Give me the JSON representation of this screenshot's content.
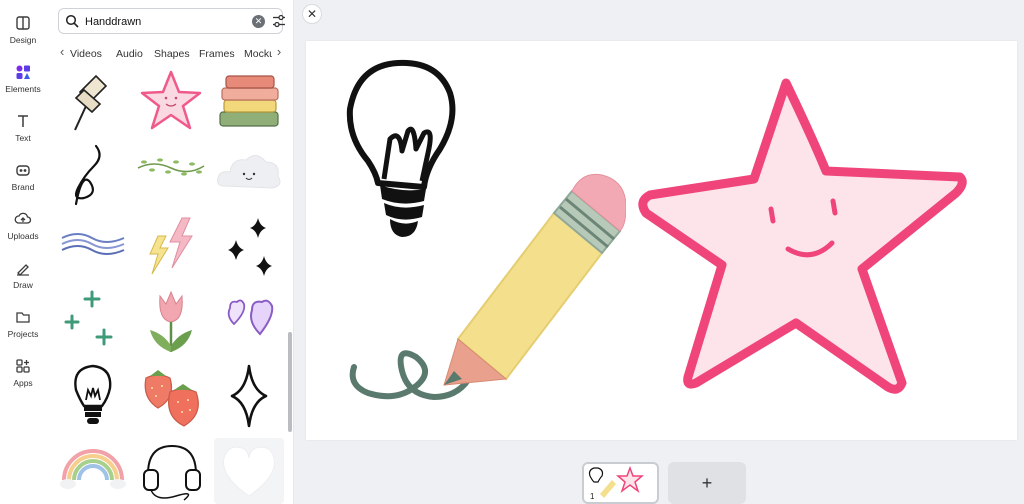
{
  "rail": {
    "items": [
      {
        "label": "Design",
        "icon": "design-icon"
      },
      {
        "label": "Elements",
        "icon": "elements-icon",
        "active": true
      },
      {
        "label": "Text",
        "icon": "text-icon"
      },
      {
        "label": "Brand",
        "icon": "brand-icon"
      },
      {
        "label": "Uploads",
        "icon": "uploads-icon"
      },
      {
        "label": "Draw",
        "icon": "draw-icon"
      },
      {
        "label": "Projects",
        "icon": "projects-icon"
      },
      {
        "label": "Apps",
        "icon": "apps-icon"
      }
    ],
    "accent": "#7d2ae8"
  },
  "search": {
    "value": "Handdrawn",
    "clear_icon": "clear-icon",
    "filter_icon": "filter-icon"
  },
  "tabs": {
    "items": [
      "Videos",
      "Audio",
      "Shapes",
      "Frames",
      "Mockups"
    ],
    "left_arrow": "‹",
    "right_arrow": "›"
  },
  "grid": {
    "items": [
      "push-pin",
      "smiling-star",
      "book-stack",
      "squiggle-loop",
      "vine-garland",
      "smiling-cloud",
      "wave-lines",
      "lightning-bolts",
      "sparkle-stars",
      "plus-sparkles",
      "tulip",
      "purple-hearts",
      "light-bulb",
      "strawberries",
      "four-point-star",
      "rainbow",
      "headphones",
      "white-heart"
    ]
  },
  "close_label": "✕",
  "canvas": {
    "elements": [
      "light-bulb",
      "pencil",
      "smiling-star"
    ],
    "colors": {
      "star_fill": "#fde3ea",
      "star_stroke": "#f0457a",
      "pencil_body": "#f3df8c",
      "pencil_eraser": "#f2a9b4",
      "pencil_tip": "#e9a08c",
      "squiggle": "#5b7a6e"
    }
  },
  "pages": {
    "current_number": "1",
    "add_label": "+"
  }
}
